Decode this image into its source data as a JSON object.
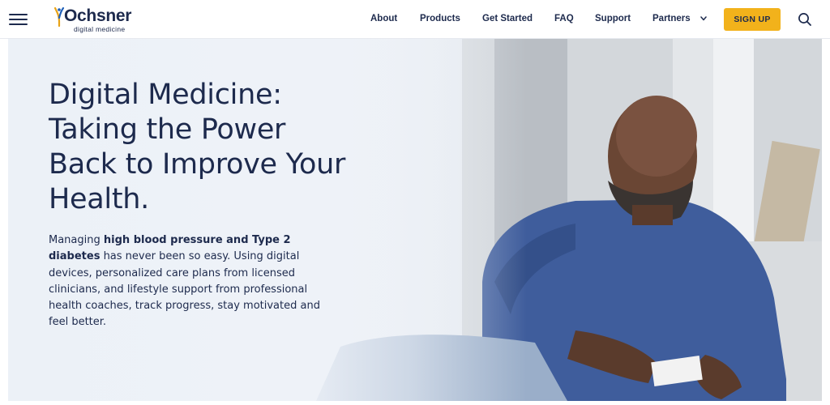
{
  "brand": {
    "name": "Ochsner",
    "tagline": "digital medicine"
  },
  "nav": {
    "items": [
      {
        "label": "About"
      },
      {
        "label": "Products"
      },
      {
        "label": "Get Started"
      },
      {
        "label": "FAQ"
      },
      {
        "label": "Support"
      },
      {
        "label": "Partners"
      }
    ],
    "signup_label": "SIGN UP"
  },
  "hero": {
    "title": "Digital Medicine: Taking the Power Back to Improve Your Health.",
    "body": {
      "lead": "Managing ",
      "bold": "high blood pressure and Type 2 diabetes",
      "rest": " has never been so easy. Using digital devices, personalized care plans from licensed clinicians, and lifestyle support from professional health coaches, track progress, stay motivated and feel better."
    }
  },
  "icons": {
    "menu": "hamburger-menu-icon",
    "search": "search-icon",
    "partners_dropdown": "chevron-down-icon",
    "logo": "ochsner-logo-mark"
  },
  "colors": {
    "navy": "#1d2a4d",
    "accent_yellow": "#f2b21b",
    "logo_gold": "#e8a317",
    "logo_blue": "#1e5fb8"
  }
}
